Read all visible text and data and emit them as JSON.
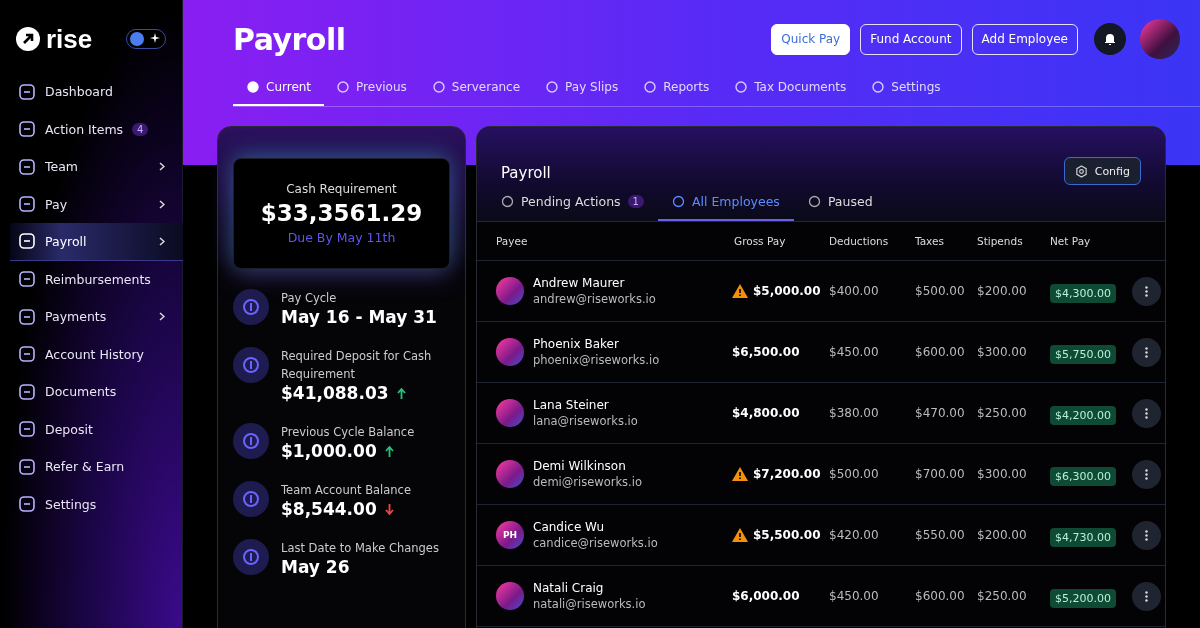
{
  "sidebar": {
    "logo": "rise",
    "theme_toggle": {
      "on": true
    },
    "items": [
      {
        "label": "Dashboard",
        "chevron": false,
        "selected": false
      },
      {
        "label": "Action Items",
        "badge": "4",
        "chevron": false,
        "selected": false
      },
      {
        "label": "Team",
        "chevron": true,
        "selected": false
      },
      {
        "label": "Pay",
        "chevron": true,
        "selected": false
      },
      {
        "label": "Payroll",
        "chevron": true,
        "selected": true
      },
      {
        "label": "Reimbursements",
        "chevron": false,
        "selected": false
      },
      {
        "label": "Payments",
        "chevron": true,
        "selected": false
      },
      {
        "label": "Account History",
        "chevron": false,
        "selected": false
      },
      {
        "label": "Documents",
        "chevron": false,
        "selected": false
      },
      {
        "label": "Deposit",
        "chevron": false,
        "selected": false
      },
      {
        "label": "Refer & Earn",
        "chevron": false,
        "selected": false
      },
      {
        "label": "Settings",
        "chevron": false,
        "selected": false
      }
    ]
  },
  "header": {
    "title": "Payroll",
    "buttons": [
      {
        "label": "Quick Pay",
        "kind": "primary"
      },
      {
        "label": "Fund Account",
        "kind": "outline"
      },
      {
        "label": "Add Employee",
        "kind": "outline"
      }
    ],
    "tabs": [
      {
        "label": "Current",
        "selected": true
      },
      {
        "label": "Previous",
        "selected": false
      },
      {
        "label": "Serverance",
        "selected": false
      },
      {
        "label": "Pay Slips",
        "selected": false
      },
      {
        "label": "Reports",
        "selected": false
      },
      {
        "label": "Tax Documents",
        "selected": false
      },
      {
        "label": "Settings",
        "selected": false
      }
    ]
  },
  "summary": {
    "cash_requirement": {
      "label": "Cash Requirement",
      "amount": "$33,3561.29",
      "due": "Due By May 11th"
    },
    "items": [
      {
        "label": "Pay Cycle",
        "value": "May 16 - May 31"
      },
      {
        "label": "Required Deposit for Cash Requirement",
        "value": "$41,088.03",
        "trend_up": true
      },
      {
        "label": "Previous Cycle Balance",
        "value": "$1,000.00",
        "trend_up": true
      },
      {
        "label": "Team Account Balance",
        "value": "$8,544.00",
        "trend_up": false
      },
      {
        "label": "Last Date to Make Changes",
        "value": "May 26"
      }
    ]
  },
  "payroll": {
    "title": "Payroll",
    "config_button": "Config",
    "tabs": [
      {
        "label": "Pending Actions",
        "badge": "1",
        "selected": false
      },
      {
        "label": "All Employees",
        "selected": true
      },
      {
        "label": "Paused",
        "selected": false
      }
    ],
    "columns": [
      "Payee",
      "Gross Pay",
      "Deductions",
      "Taxes",
      "Stipends",
      "Net Pay"
    ],
    "rows": [
      {
        "name": "Andrew Maurer",
        "email": "andrew@riseworks.io",
        "warning": true,
        "gross": "$5,000.00",
        "deductions": "$400.00",
        "taxes": "$500.00",
        "stipends": "$200.00",
        "net": "$4,300.00"
      },
      {
        "name": "Phoenix Baker",
        "email": "phoenix@riseworks.io",
        "warning": false,
        "gross": "$6,500.00",
        "deductions": "$450.00",
        "taxes": "$600.00",
        "stipends": "$300.00",
        "net": "$5,750.00"
      },
      {
        "name": "Lana Steiner",
        "email": "lana@riseworks.io",
        "warning": false,
        "gross": "$4,800.00",
        "deductions": "$380.00",
        "taxes": "$470.00",
        "stipends": "$250.00",
        "net": "$4,200.00"
      },
      {
        "name": "Demi Wilkinson",
        "email": "demi@riseworks.io",
        "warning": true,
        "gross": "$7,200.00",
        "deductions": "$500.00",
        "taxes": "$700.00",
        "stipends": "$300.00",
        "net": "$6,300.00"
      },
      {
        "name": "Candice Wu",
        "email": "candice@riseworks.io",
        "initials": "PH",
        "warning": true,
        "gross": "$5,500.00",
        "deductions": "$420.00",
        "taxes": "$550.00",
        "stipends": "$200.00",
        "net": "$4,730.00"
      },
      {
        "name": "Natali Craig",
        "email": "natali@riseworks.io",
        "warning": false,
        "gross": "$6,000.00",
        "deductions": "$450.00",
        "taxes": "$600.00",
        "stipends": "$250.00",
        "net": "$5,200.00"
      }
    ]
  }
}
